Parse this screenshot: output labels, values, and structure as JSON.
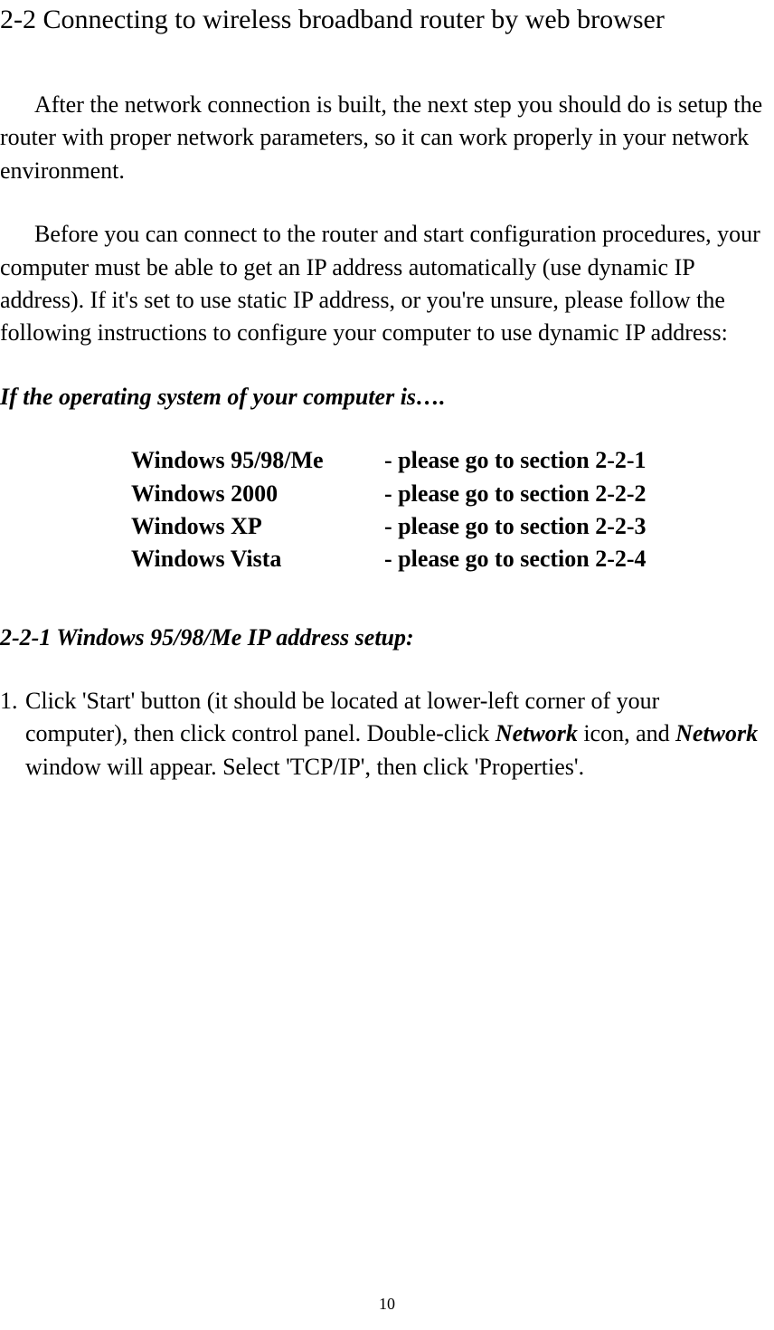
{
  "sectionTitle": "2-2 Connecting to wireless broadband router by web browser",
  "para1": "After the network connection is built, the next step you should do is setup the router with proper network parameters, so it can work properly in your network environment.",
  "para2": "Before you can connect to the router and start configuration procedures, your computer must be able to get an IP address automatically (use dynamic IP address). If it's set to use static IP address, or you're unsure, please follow the following instructions to configure your computer to use dynamic IP address:",
  "osIntro": "If the operating system of your computer is….",
  "osTable": [
    {
      "name": "Windows 95/98/Me",
      "section": "- please go to section 2-2-1"
    },
    {
      "name": "Windows 2000",
      "section": "- please go to section 2-2-2"
    },
    {
      "name": "Windows XP",
      "section": "- please go to section 2-2-3"
    },
    {
      "name": "Windows Vista",
      "section": "- please go to section 2-2-4"
    }
  ],
  "subsectionTitle": "2-2-1 Windows 95/98/Me IP address setup:",
  "step1": {
    "num": "1.",
    "t1": "Click 'Start' button (it should be located at lower-left corner of your computer), then click control panel. Double-click ",
    "i1": "Network",
    "t2": " icon, and ",
    "i2": "Network",
    "t3": " window will appear. Select 'TCP/IP', then click 'Properties'."
  },
  "pageNumber": "10"
}
